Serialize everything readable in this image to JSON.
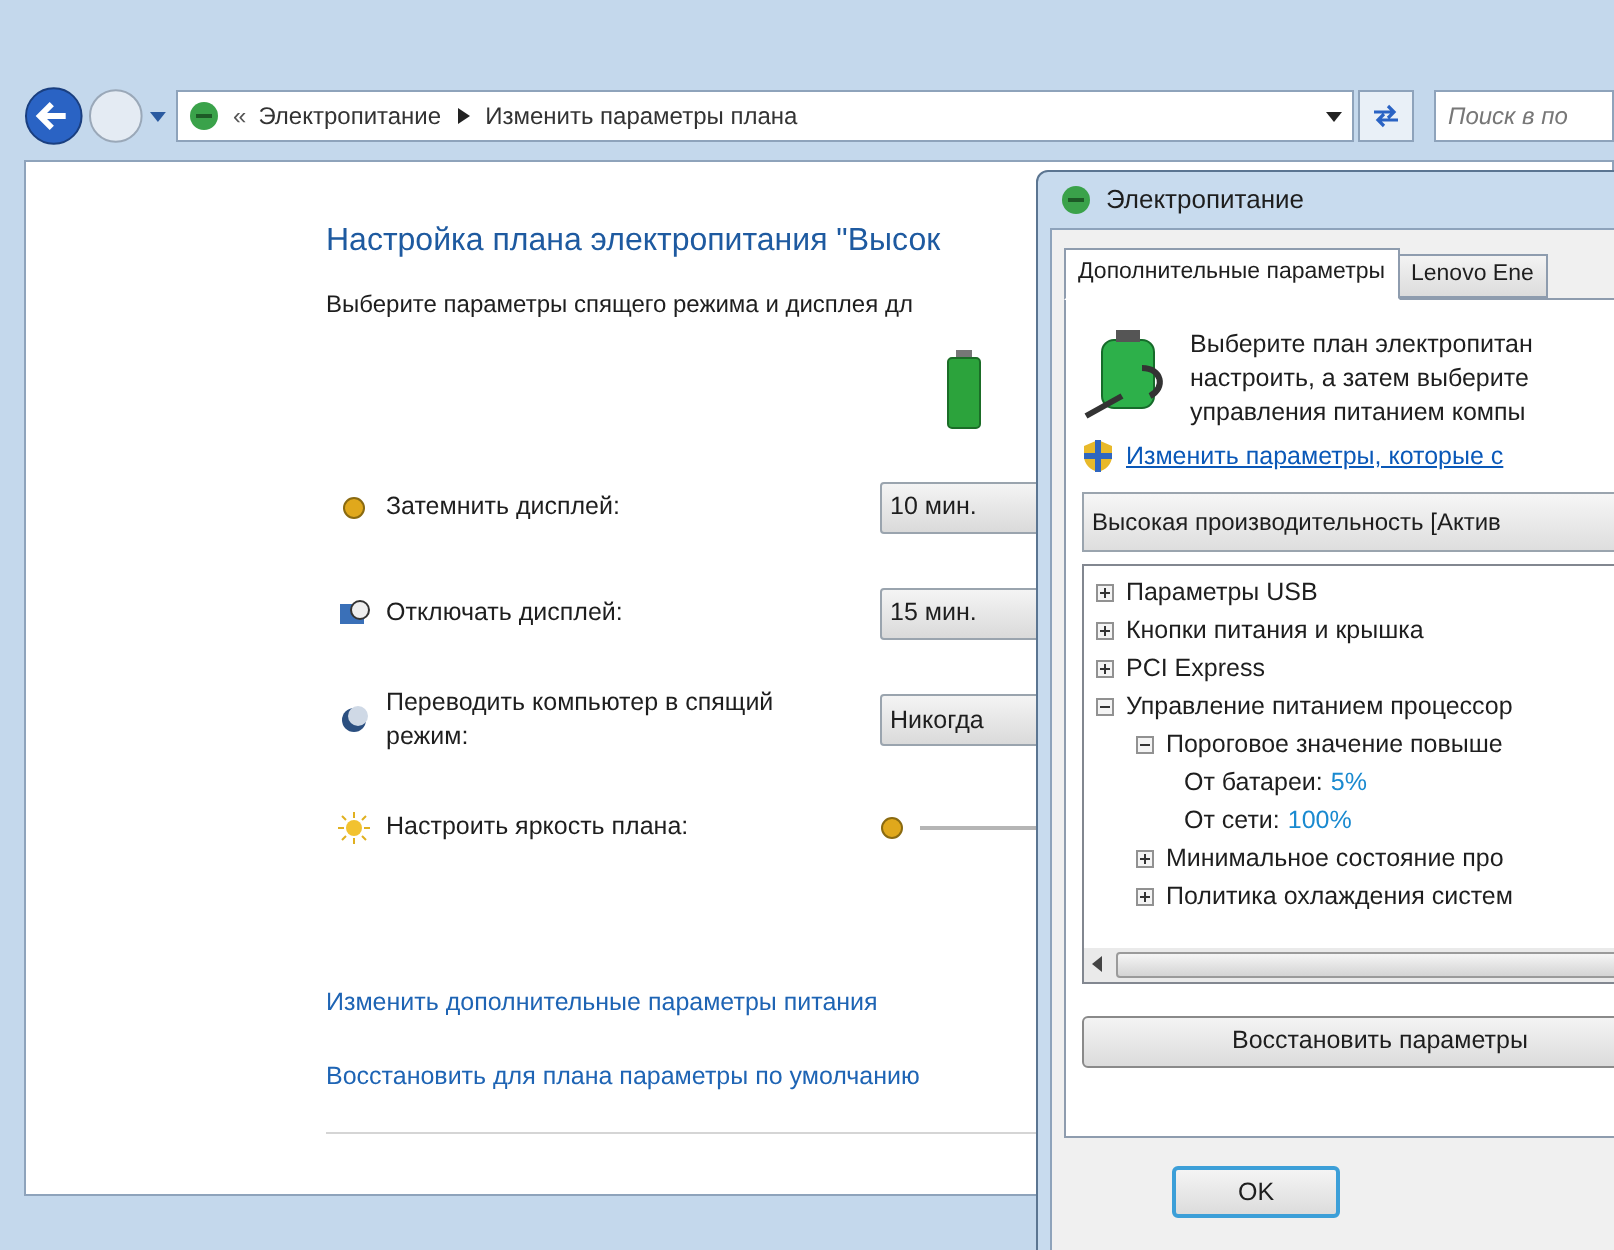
{
  "explorer": {
    "breadcrumb_prefix": "«",
    "breadcrumbs": [
      "Электропитание",
      "Изменить параметры плана"
    ],
    "search": {
      "placeholder": "Поиск в по"
    }
  },
  "plan": {
    "title": "Настройка плана электропитания \"Высок",
    "subtitle": "Выберите параметры спящего режима и дисплея дл",
    "settings": [
      {
        "kind": "dropdown",
        "label": "Затемнить дисплей:",
        "value": "10 мин."
      },
      {
        "kind": "dropdown",
        "label": "Отключать дисплей:",
        "value": "15 мин."
      },
      {
        "kind": "dropdown",
        "label": "Переводить компьютер в спящий режим:",
        "value": "Никогда"
      },
      {
        "kind": "slider",
        "label": "Настроить яркость плана:"
      }
    ],
    "links": [
      "Изменить дополнительные параметры питания",
      "Восстановить для плана параметры по умолчанию"
    ]
  },
  "dialog": {
    "title": "Электропитание",
    "tabs": [
      {
        "label": "Дополнительные параметры",
        "selected": true
      },
      {
        "label": "Lenovo Ene",
        "selected": false
      }
    ],
    "intro": "Выберите план электропитан\nнастроить, а затем выберите\nуправления питанием компы",
    "admin_link": "Изменить параметры, которые с",
    "plan_select": "Высокая производительность [Актив",
    "tree": [
      {
        "label": "Параметры USB",
        "expanded": false
      },
      {
        "label": "Кнопки питания и крышка",
        "expanded": false
      },
      {
        "label": "PCI Express",
        "expanded": false
      },
      {
        "label": "Управление питанием процессор",
        "expanded": true,
        "children": [
          {
            "label": "Пороговое значение повыше",
            "expanded": true,
            "children": [
              {
                "label": "От батареи:",
                "value": "5%"
              },
              {
                "label": "От сети:",
                "value": "100%"
              }
            ]
          },
          {
            "label": "Минимальное состояние про",
            "expanded": false
          },
          {
            "label": "Политика охлаждения систем",
            "expanded": false
          }
        ]
      }
    ],
    "restore_button": "Восстановить параметры",
    "buttons": [
      "OK"
    ]
  }
}
